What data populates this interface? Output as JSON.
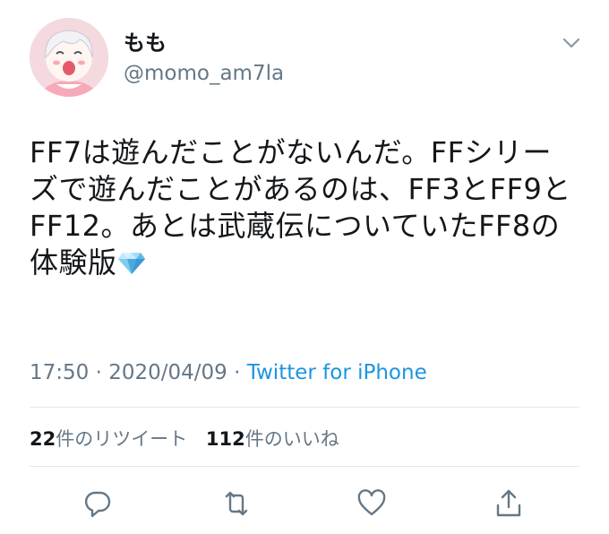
{
  "user": {
    "display_name": "もも",
    "handle": "@momo_am7la"
  },
  "tweet": {
    "text": "FF7は遊んだことがないんだ。FFシリーズで遊んだことがあるのは、FF3とFF9とFF12。あとは武蔵伝についていたFF8の体験版",
    "emoji": "gem-stone"
  },
  "meta": {
    "time": "17:50",
    "separator1": " · ",
    "date": "2020/04/09",
    "separator2": " · ",
    "source": "Twitter for iPhone"
  },
  "stats": {
    "retweets_count": "22",
    "retweets_label": "件のリツイート",
    "likes_count": "112",
    "likes_label": "件のいいね"
  },
  "icons": {
    "menu": "chevron-down-icon",
    "reply": "reply-icon",
    "retweet": "retweet-icon",
    "like": "heart-icon",
    "share": "share-icon"
  },
  "colors": {
    "text": "#14171a",
    "secondary": "#657786",
    "link": "#1b95e0",
    "divider": "#e1e8ed",
    "icon": "#657786"
  }
}
